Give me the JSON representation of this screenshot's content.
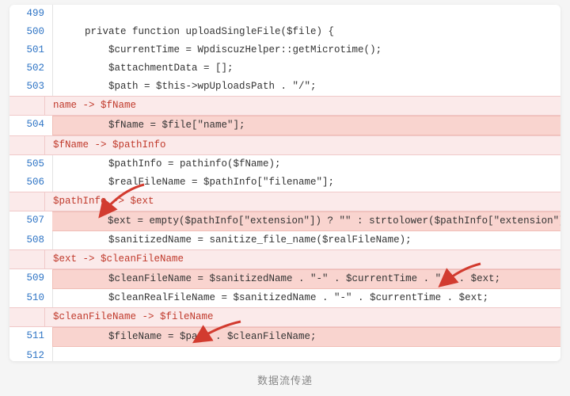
{
  "caption": "数据流传递",
  "code": {
    "lines": {
      "499": "",
      "500": "    private function uploadSingleFile($file) {",
      "501": "        $currentTime = WpdiscuzHelper::getMicrotime();",
      "502": "        $attachmentData = [];",
      "503": "        $path = $this->wpUploadsPath . \"/\";",
      "504": "        $fName = $file[\"name\"];",
      "505": "        $pathInfo = pathinfo($fName);",
      "506": "        $realFileName = $pathInfo[\"filename\"];",
      "507": "        $ext = empty($pathInfo[\"extension\"]) ? \"\" : strtolower($pathInfo[\"extension\"]);",
      "508": "        $sanitizedName = sanitize_file_name($realFileName);",
      "509": "        $cleanFileName = $sanitizedName . \"-\" . $currentTime . \".\" . $ext;",
      "510": "        $cleanRealFileName = $sanitizedName . \"-\" . $currentTime . $ext;",
      "511": "        $fileName = $path . $cleanFileName;",
      "512": ""
    },
    "labels": {
      "l1": "name -> $fName",
      "l2": "$fName -> $pathInfo",
      "l3": "$pathInfo -> $ext",
      "l4": "$ext -> $cleanFileName",
      "l5": "$cleanFileName -> $fileName"
    }
  },
  "line_numbers": {
    "n499": "499",
    "n500": "500",
    "n501": "501",
    "n502": "502",
    "n503": "503",
    "n504": "504",
    "n505": "505",
    "n506": "506",
    "n507": "507",
    "n508": "508",
    "n509": "509",
    "n510": "510",
    "n511": "511",
    "n512": "512"
  },
  "arrows": {
    "note": "Red arrows annotate data-flow targets on lines 507, 509 and 511",
    "targets": [
      "line-507-ext",
      "line-509-ext-var",
      "line-511-cleanFileName"
    ]
  }
}
